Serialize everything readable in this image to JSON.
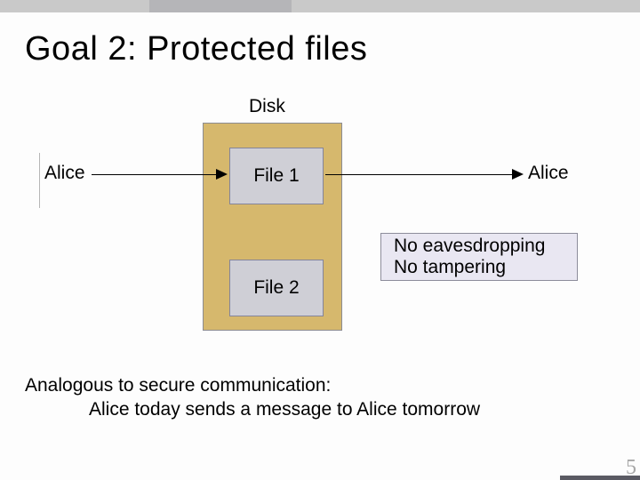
{
  "title": "Goal 2:   Protected files",
  "diskLabel": "Disk",
  "file1": "File 1",
  "file2": "File 2",
  "aliceLeft": "Alice",
  "aliceRight": "Alice",
  "callout": {
    "line1": "No eavesdropping",
    "line2": "No tampering"
  },
  "body": {
    "line1": "Analogous to secure communication:",
    "line2": "Alice today sends a message to Alice tomorrow"
  },
  "pageNum": "5"
}
